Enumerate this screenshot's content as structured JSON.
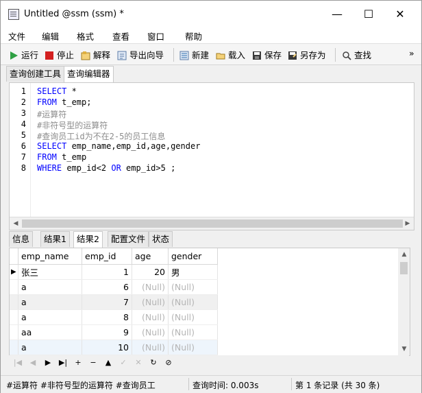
{
  "window": {
    "title": "Untitled @ssm (ssm) *",
    "minimize": "—",
    "maximize": "☐",
    "close": "✕"
  },
  "menu": [
    "文件",
    "编辑",
    "格式",
    "查看",
    "窗口",
    "帮助"
  ],
  "toolbar": {
    "run": "运行",
    "stop": "停止",
    "explain": "解释",
    "export_wizard": "导出向导",
    "new": "新建",
    "load": "载入",
    "save": "保存",
    "save_as": "另存为",
    "find": "查找",
    "overflow": "»"
  },
  "editor_tabs": [
    "查询创建工具",
    "查询编辑器"
  ],
  "line_numbers": [
    "1",
    "2",
    "3",
    "4",
    "5",
    "6",
    "7",
    "8"
  ],
  "code": {
    "l1_kw": "SELECT",
    "l1_rest": " *",
    "l2_kw": "FROM",
    "l2_rest": " t_emp;",
    "l3": "#运算符",
    "l4": "#非符号型的运算符",
    "l5": "#查询员工id为不在2-5的员工信息",
    "l6_kw": "SELECT",
    "l6_rest": " emp_name,emp_id,age,gender",
    "l7_kw": "FROM",
    "l7_rest": " t_emp",
    "l8_kw1": "WHERE",
    "l8_a": " emp_id<2 ",
    "l8_kw2": "OR",
    "l8_b": " emp_id>5 ;"
  },
  "result_tabs": [
    "信息",
    "结果1",
    "结果2",
    "配置文件",
    "状态"
  ],
  "grid": {
    "columns": [
      "emp_name",
      "emp_id",
      "age",
      "gender"
    ],
    "rows": [
      {
        "emp_name": "张三",
        "emp_id": "1",
        "age": "20",
        "gender": "男"
      },
      {
        "emp_name": "a",
        "emp_id": "6",
        "age": "(Null)",
        "gender": "(Null)"
      },
      {
        "emp_name": "a",
        "emp_id": "7",
        "age": "(Null)",
        "gender": "(Null)"
      },
      {
        "emp_name": "a",
        "emp_id": "8",
        "age": "(Null)",
        "gender": "(Null)"
      },
      {
        "emp_name": "aa",
        "emp_id": "9",
        "age": "(Null)",
        "gender": "(Null)"
      },
      {
        "emp_name": "a",
        "emp_id": "10",
        "age": "(Null)",
        "gender": "(Null)"
      }
    ],
    "current_row_marker": "▶"
  },
  "nav_buttons": [
    "|◀",
    "◀",
    "▶",
    "▶|",
    "+",
    "−",
    "▲",
    "✓",
    "✕",
    "↻",
    "⊘"
  ],
  "status": {
    "sql": "#运算符 #非符号型的运算符 #查询员工",
    "query_time": "查询时间: 0.003s",
    "records": "第 1 条记录 (共 30 条)"
  },
  "colors": {
    "keyword": "#0000ff",
    "comment": "#8c8c8c",
    "null_text": "#b5b5b5",
    "run_icon": "#2ea043",
    "stop_icon": "#d32020"
  }
}
